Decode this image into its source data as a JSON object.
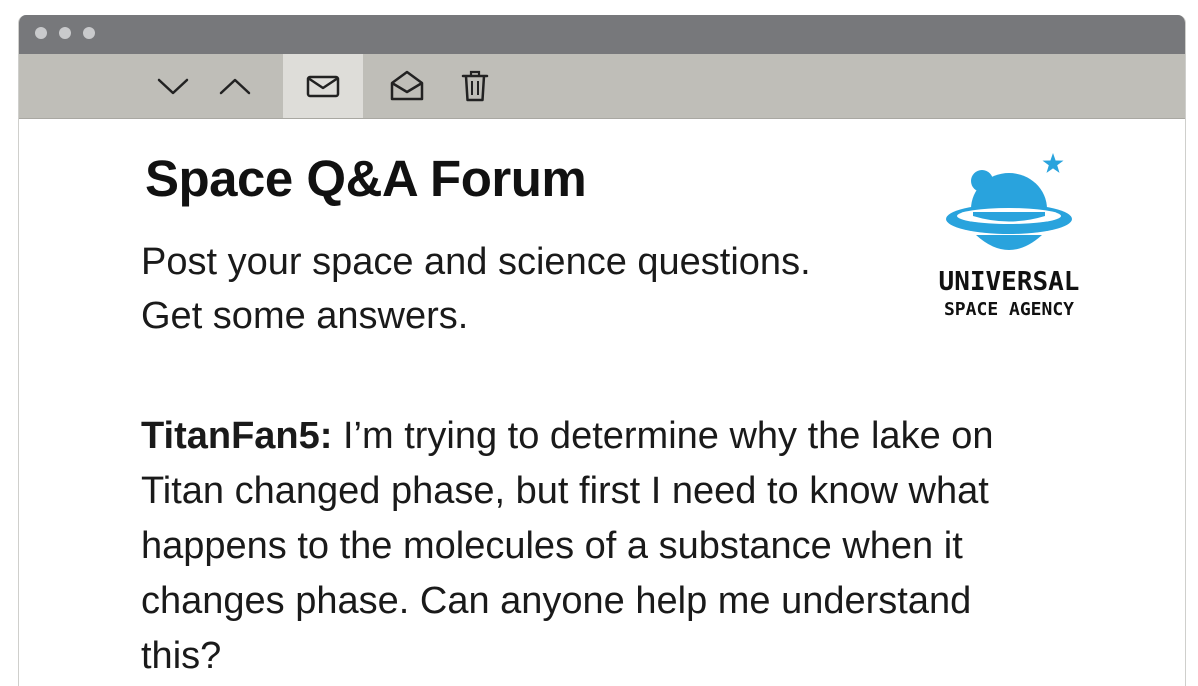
{
  "window": {
    "accent": "#29a3dd",
    "titlebar_color": "#77787b",
    "toolbar_color": "#bfbeb8"
  },
  "toolbar": {
    "buttons": [
      {
        "icon": "chevron-down-icon",
        "label": "Next message"
      },
      {
        "icon": "chevron-up-icon",
        "label": "Previous message"
      },
      {
        "icon": "envelope-closed-icon",
        "label": "Mark unread",
        "active": true
      },
      {
        "icon": "envelope-open-icon",
        "label": "Mark read"
      },
      {
        "icon": "trash-icon",
        "label": "Delete"
      }
    ]
  },
  "page": {
    "title": "Space Q&A Forum",
    "subtitle_line1": "Post your space and science questions.",
    "subtitle_line2": "Get some answers."
  },
  "logo": {
    "line1": "UNIVERSAL",
    "line2": "SPACE AGENCY",
    "icon": "planet-logo-icon"
  },
  "post": {
    "author": "TitanFan5:",
    "text": " I’m trying to determine why the lake on Titan changed phase, but first I need to know what happens to the molecules of a substance when it changes phase. Can anyone help me understand this?"
  }
}
